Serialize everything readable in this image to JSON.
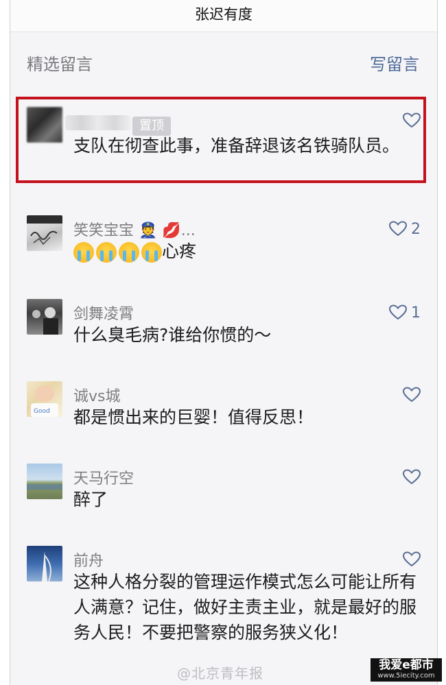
{
  "header": {
    "title": "张迟有度"
  },
  "section": {
    "title": "精选留言",
    "write_label": "写留言"
  },
  "pinned": {
    "badge": "置顶",
    "content": "支队在彻查此事，准备辞退该名铁骑队员。"
  },
  "comments": [
    {
      "name": "笑笑宝宝",
      "name_suffix": "👮 💋...",
      "content_text": "心疼",
      "likes": "2",
      "crying_emoji_count": 4
    },
    {
      "name": "剑舞凌霄",
      "content": "什么臭毛病?谁给你惯的～",
      "likes": "1"
    },
    {
      "name": "诚vs城",
      "content": "都是惯出来的巨婴！值得反思！",
      "likes": ""
    },
    {
      "name": "天马行空",
      "content": "醉了",
      "likes": ""
    },
    {
      "name": "前舟",
      "content": "这种人格分裂的管理运作模式怎么可能让所有人满意？记住，做好主责主业，就是最好的服务人民！不要把警察的服务狭义化！",
      "likes": ""
    }
  ],
  "watermark": "@北京青年报",
  "site_badge": {
    "main": "我爱e都市",
    "sub": "www.5iecity.com"
  },
  "colors": {
    "accent": "#4f6b97",
    "highlight_border": "#c4121d",
    "heart": "#5a6f93"
  }
}
